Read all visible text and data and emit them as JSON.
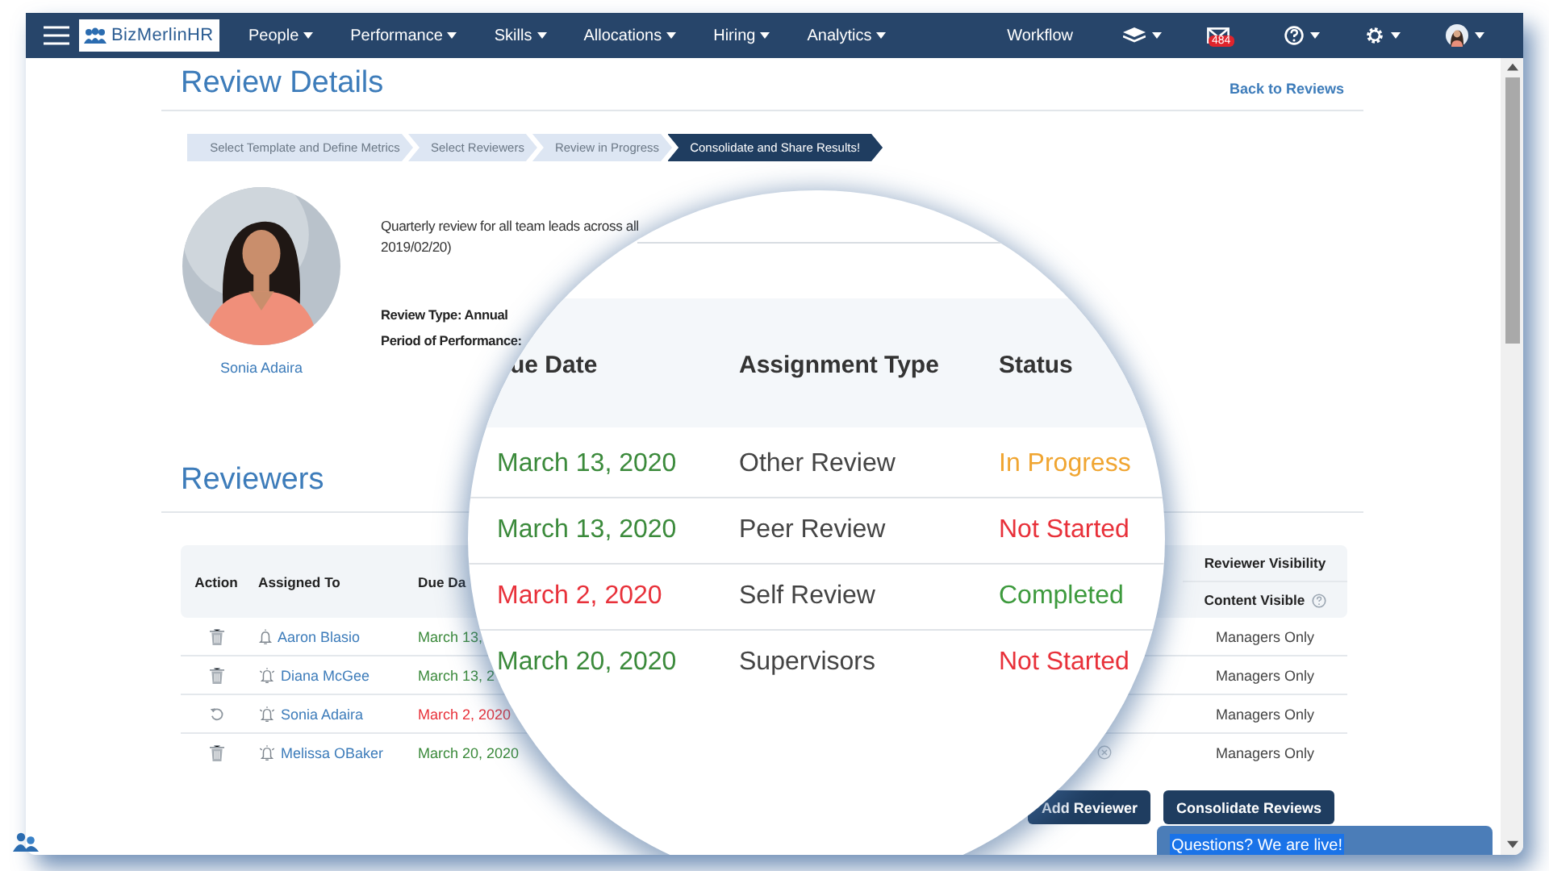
{
  "nav": {
    "logo": "BizMerlinHR",
    "menus": [
      "People",
      "Performance",
      "Skills",
      "Allocations",
      "Hiring",
      "Analytics"
    ],
    "workflow": "Workflow",
    "mail_badge": "484"
  },
  "page": {
    "title": "Review Details",
    "back_link": "Back to Reviews"
  },
  "steps": [
    {
      "label": "Select Template and Define Metrics",
      "selected": false
    },
    {
      "label": "Select Reviewers",
      "selected": false
    },
    {
      "label": "Review in Progress",
      "selected": false
    },
    {
      "label": "Consolidate and Share Results!",
      "selected": true
    }
  ],
  "profile": {
    "name": "Sonia Adaira",
    "description": [
      "Quarterly review for all team leads across all",
      "2019/02/20)"
    ],
    "review_type": "Review Type: Annual",
    "period": "Period of Performance:"
  },
  "reviewers": {
    "title": "Reviewers",
    "columns": {
      "action": "Action",
      "assigned_to": "Assigned To",
      "due_date": "Due Da",
      "visibility_group": "Reviewer Visibility",
      "visibility": "Content Visible"
    },
    "rows": [
      {
        "kind": "delete",
        "reminder_sent": false,
        "name": "Aaron Blasio",
        "due_date": "March 13,",
        "overdue": false,
        "clear_icon": false,
        "visibility": "Managers Only"
      },
      {
        "kind": "delete",
        "reminder_sent": true,
        "name": "Diana McGee",
        "due_date": "March 13, 2",
        "overdue": false,
        "clear_icon": false,
        "visibility": "Managers Only"
      },
      {
        "kind": "reopen",
        "reminder_sent": true,
        "name": "Sonia Adaira",
        "due_date": "March 2, 2020",
        "overdue": true,
        "clear_icon": false,
        "visibility": "Managers Only"
      },
      {
        "kind": "delete",
        "reminder_sent": true,
        "name": "Melissa OBaker",
        "due_date": "March 20, 2020",
        "overdue": false,
        "clear_icon": true,
        "visibility": "Managers Only"
      }
    ]
  },
  "buttons": [
    "Add Reviewer",
    "Consolidate Reviews"
  ],
  "magnifier": {
    "columns": [
      "ue Date",
      "Assignment Type",
      "Status"
    ],
    "rows": [
      {
        "due_date": "March 13, 2020",
        "overdue": false,
        "type": "Other Review",
        "status": "In Progress",
        "color": "#f0a531"
      },
      {
        "due_date": "March 13, 2020",
        "overdue": false,
        "type": "Peer Review",
        "status": "Not Started",
        "color": "#e8313a"
      },
      {
        "due_date": "March 2, 2020",
        "overdue": true,
        "type": "Self Review",
        "status": "Completed",
        "color": "#3d9a3d"
      },
      {
        "due_date": "March 20, 2020",
        "overdue": false,
        "type": "Supervisors",
        "status": "Not Started",
        "color": "#e8313a"
      }
    ]
  },
  "chat": {
    "label": "Questions? We are live!"
  }
}
